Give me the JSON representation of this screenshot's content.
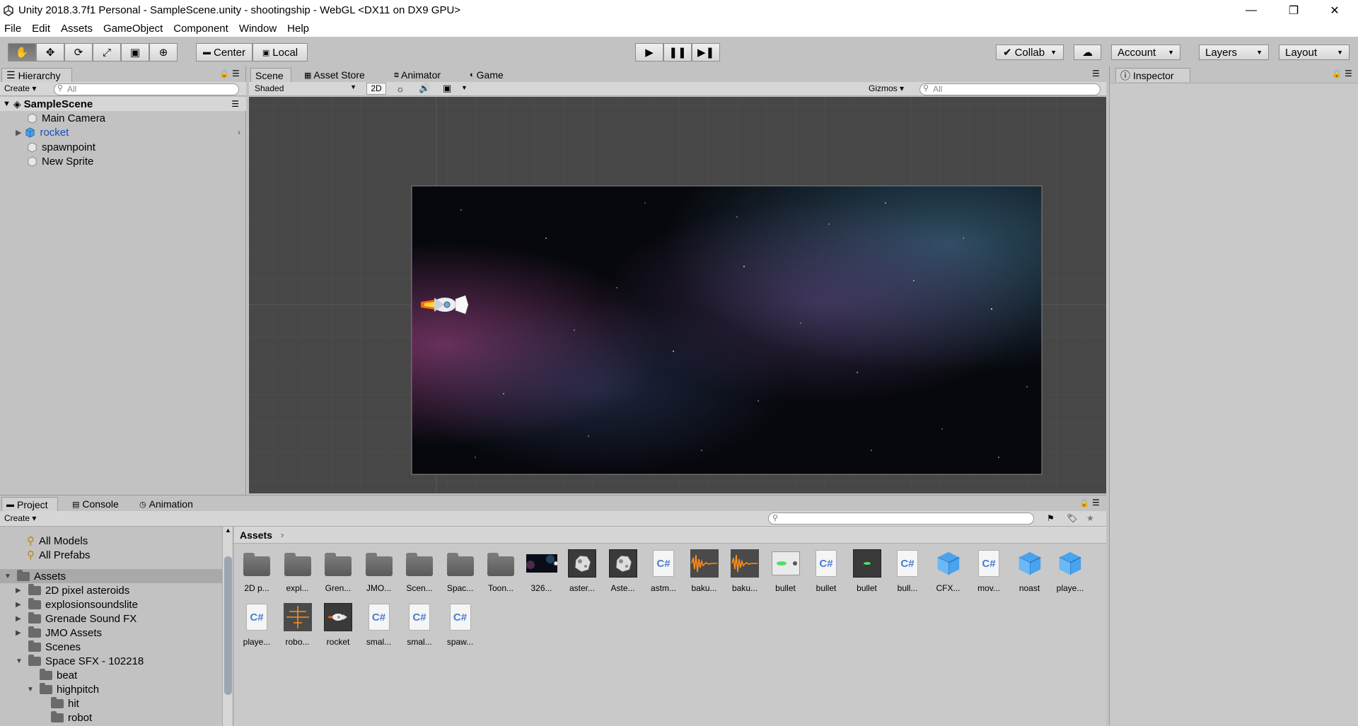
{
  "window": {
    "title": "Unity 2018.3.7f1 Personal - SampleScene.unity - shootingship - WebGL <DX11 on DX9 GPU>",
    "controls": {
      "minimize": "—",
      "maximize": "❐",
      "close": "✕"
    }
  },
  "menu": [
    "File",
    "Edit",
    "Assets",
    "GameObject",
    "Component",
    "Window",
    "Help"
  ],
  "toolbar": {
    "pivot_center": "Center",
    "pivot_local": "Local",
    "collab": "Collab",
    "account": "Account",
    "layers": "Layers",
    "layout": "Layout"
  },
  "hierarchy": {
    "tab": "Hierarchy",
    "create": "Create",
    "search_placeholder": "All",
    "scene": "SampleScene",
    "items": [
      "Main Camera",
      "rocket",
      "spawnpoint",
      "New Sprite"
    ]
  },
  "scene_tabs": [
    "Scene",
    "Asset Store",
    "Animator",
    "Game"
  ],
  "scene_toolbar": {
    "shading": "Shaded",
    "mode2d": "2D",
    "gizmos": "Gizmos",
    "search_placeholder": "All"
  },
  "inspector": {
    "tab": "Inspector"
  },
  "bottom_tabs": [
    "Project",
    "Console",
    "Animation"
  ],
  "project": {
    "create": "Create",
    "breadcrumb": "Assets",
    "favorites": [
      "All Models",
      "All Prefabs"
    ],
    "tree": [
      {
        "label": "Assets",
        "depth": 0,
        "expanded": true,
        "selected": true
      },
      {
        "label": "2D pixel asteroids",
        "depth": 1,
        "expanded": false
      },
      {
        "label": "explosionsoundslite",
        "depth": 1,
        "expanded": false
      },
      {
        "label": "Grenade Sound FX",
        "depth": 1,
        "expanded": false
      },
      {
        "label": "JMO Assets",
        "depth": 1,
        "expanded": false
      },
      {
        "label": "Scenes",
        "depth": 1,
        "expanded": null
      },
      {
        "label": "Space SFX - 102218",
        "depth": 1,
        "expanded": true
      },
      {
        "label": "beat",
        "depth": 2,
        "expanded": null
      },
      {
        "label": "highpitch",
        "depth": 2,
        "expanded": true
      },
      {
        "label": "hit",
        "depth": 3,
        "expanded": null
      },
      {
        "label": "robot",
        "depth": 3,
        "expanded": null
      }
    ],
    "assets_row1": [
      {
        "label": "2D p...",
        "kind": "folder"
      },
      {
        "label": "expl...",
        "kind": "folder"
      },
      {
        "label": "Gren...",
        "kind": "folder"
      },
      {
        "label": "JMO...",
        "kind": "folder"
      },
      {
        "label": "Scen...",
        "kind": "folder"
      },
      {
        "label": "Spac...",
        "kind": "folder"
      },
      {
        "label": "Toon...",
        "kind": "folder"
      },
      {
        "label": "326...",
        "kind": "space"
      },
      {
        "label": "aster...",
        "kind": "asteroid"
      },
      {
        "label": "Aste...",
        "kind": "asteroid"
      },
      {
        "label": "astm...",
        "kind": "cs"
      },
      {
        "label": "baku...",
        "kind": "audio"
      },
      {
        "label": "baku...",
        "kind": "audio"
      },
      {
        "label": "bullet",
        "kind": "bulletlight"
      },
      {
        "label": "bullet",
        "kind": "cs"
      },
      {
        "label": "bullet",
        "kind": "bulletdark"
      },
      {
        "label": "bull...",
        "kind": "cs"
      },
      {
        "label": "CFX...",
        "kind": "cube"
      },
      {
        "label": "mov...",
        "kind": "cs"
      },
      {
        "label": "noast",
        "kind": "cube"
      },
      {
        "label": "playe...",
        "kind": "cube"
      }
    ],
    "assets_row2": [
      {
        "label": "playe...",
        "kind": "cs"
      },
      {
        "label": "robo...",
        "kind": "audio2"
      },
      {
        "label": "rocket",
        "kind": "rocket"
      },
      {
        "label": "smal...",
        "kind": "cs"
      },
      {
        "label": "smal...",
        "kind": "cs"
      },
      {
        "label": "spaw...",
        "kind": "cs"
      }
    ]
  },
  "icons": {
    "cs_text": "C#"
  }
}
